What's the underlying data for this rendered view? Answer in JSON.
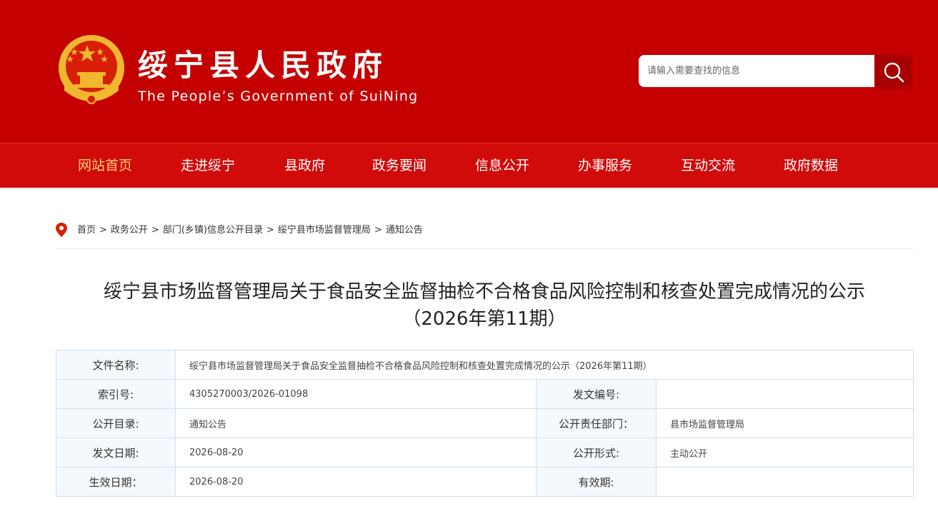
{
  "header": {
    "title": "绥宁县人民政府",
    "subtitle": "The People’s Government of SuiNing",
    "emblem_icon": "national-emblem-icon",
    "search": {
      "placeholder": "请输入需要查找的信息",
      "icon": "search-icon"
    }
  },
  "nav": {
    "items": [
      {
        "label": "网站首页",
        "active": true
      },
      {
        "label": "走进绥宁",
        "active": false
      },
      {
        "label": "县政府",
        "active": false
      },
      {
        "label": "政务要闻",
        "active": false
      },
      {
        "label": "信息公开",
        "active": false
      },
      {
        "label": "办事服务",
        "active": false
      },
      {
        "label": "互动交流",
        "active": false
      },
      {
        "label": "政府数据",
        "active": false
      }
    ]
  },
  "breadcrumb": {
    "icon": "location-pin-icon",
    "items": [
      "首页",
      "政务公开",
      "部门(乡镇)信息公开目录",
      "绥宁县市场监督管理局",
      "通知公告"
    ],
    "separator": ">"
  },
  "article": {
    "title_line1": "绥宁县市场监督管理局关于食品安全监督抽检不合格食品风险控制和核查处置完成情况的公示",
    "title_line2": "（2026年第11期）"
  },
  "meta": {
    "file_name_label": "文件名称:",
    "file_name": "绥宁县市场监督管理局关于食品安全监督抽检不合格食品风险控制和核查处置完成情况的公示（2026年第11期）",
    "index_label": "索引号:",
    "index": "4305270003/2026-01098",
    "doc_no_label": "发文编号:",
    "doc_no": "",
    "catalog_label": "公开目录:",
    "catalog": "通知公告",
    "dept_label": "公开责任部门：",
    "dept": "县市场监督管理局",
    "issue_date_label": "发文日期:",
    "issue_date": "2026-08-20",
    "form_label": "公开形式:",
    "form": "主动公开",
    "effective_label": "生效日期：",
    "effective_date": "2026-08-20",
    "validity_label": "有效期:",
    "validity": ""
  },
  "colors": {
    "header_red": "#c40000",
    "nav_red": "#d10a0a",
    "nav_active": "#ffd27a",
    "emblem_gold": "#f0b72f"
  }
}
